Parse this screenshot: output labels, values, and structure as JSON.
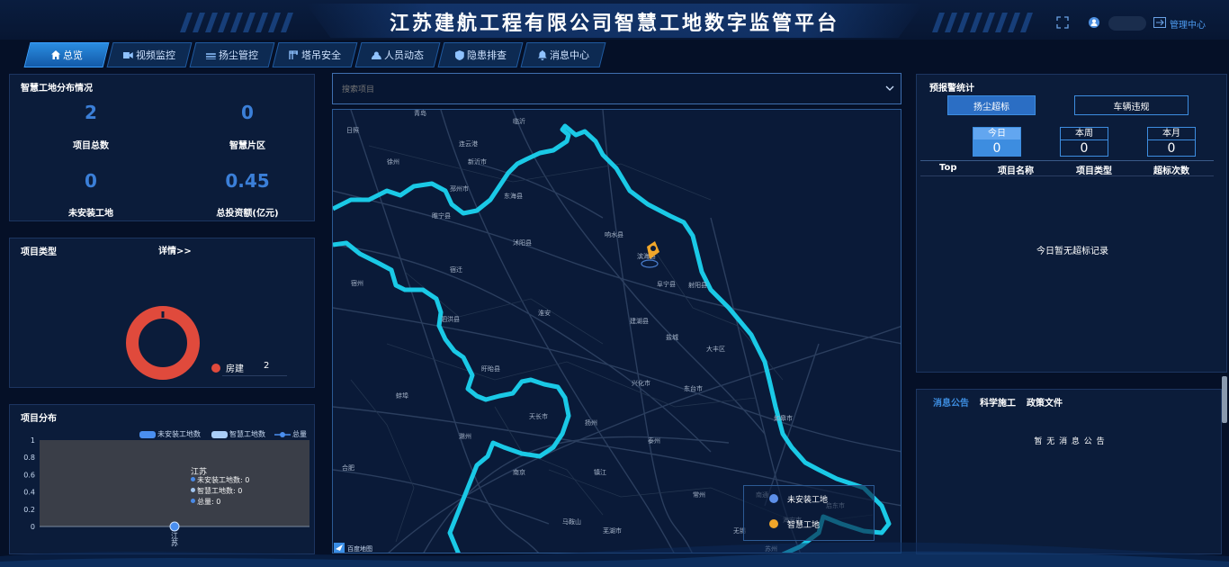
{
  "header": {
    "title": "江苏建航工程有限公司智慧工地数字监管平台",
    "manage_label": "管理中心"
  },
  "nav": {
    "tabs": [
      {
        "label": "总览",
        "icon": "home-icon"
      },
      {
        "label": "视频监控",
        "icon": "video-icon"
      },
      {
        "label": "扬尘管控",
        "icon": "dust-icon"
      },
      {
        "label": "塔吊安全",
        "icon": "crane-icon"
      },
      {
        "label": "人员动态",
        "icon": "person-icon"
      },
      {
        "label": "隐患排查",
        "icon": "shield-icon"
      },
      {
        "label": "消息中心",
        "icon": "bell-icon"
      }
    ]
  },
  "distribution": {
    "title": "智慧工地分布情况",
    "stats": [
      {
        "value": "2",
        "label": "项目总数"
      },
      {
        "value": "0",
        "label": "智慧片区"
      },
      {
        "value": "0",
        "label": "未安装工地"
      },
      {
        "value": "0.45",
        "label": "总投资额(亿元)"
      }
    ]
  },
  "project_type": {
    "title": "项目类型",
    "detail_link": "详情>>",
    "legend": {
      "name": "房建",
      "value": "2"
    },
    "color": "#e04a3c"
  },
  "project_dist": {
    "title": "项目分布",
    "tooltip": {
      "title": "江苏",
      "lines": [
        "未安装工地数: 0",
        "智慧工地数: 0",
        "总量: 0"
      ]
    }
  },
  "chart_data": {
    "type": "bar",
    "categories": [
      "江苏"
    ],
    "series": [
      {
        "name": "未安装工地数",
        "values": [
          0
        ]
      },
      {
        "name": "智慧工地数",
        "values": [
          0
        ]
      },
      {
        "name": "总量",
        "values": [
          0
        ]
      }
    ],
    "yticks": [
      "0",
      "0.2",
      "0.4",
      "0.6",
      "0.8",
      "1"
    ],
    "ylim": [
      0,
      1
    ],
    "xtick_label": "江苏",
    "legend_position": "top-right",
    "colors": {
      "uninstalled": "#4a8ff0",
      "smart": "#a9cdf7",
      "total": "#4a8ff0"
    }
  },
  "search": {
    "placeholder": "搜索项目"
  },
  "map": {
    "logo_text": "百度地图",
    "legend": [
      "未安装工地",
      "智慧工地"
    ],
    "legend_colors": [
      "#5d8fe8",
      "#f0a62a"
    ],
    "boundary_color": "#1ac9e6",
    "city_labels": [
      "青岛",
      "临沂",
      "日照",
      "连云港",
      "东海县",
      "宿迁",
      "沭阳县",
      "泗洪县",
      "淮安",
      "盐城",
      "建湖县",
      "阜宁县",
      "滨海县",
      "响水县",
      "射阳县",
      "大丰区",
      "东台市",
      "兴化市",
      "泰州",
      "扬州",
      "南京",
      "镇江",
      "常州",
      "无锡",
      "苏州",
      "南通",
      "如皋市",
      "海安市",
      "启东市",
      "马鞍山",
      "芜湖市",
      "滁州",
      "天长市",
      "盱眙县",
      "徐州",
      "邳州市",
      "新沂市",
      "睢宁县",
      "宿州",
      "蚌埠",
      "合肥"
    ]
  },
  "alert": {
    "title": "预报警统计",
    "tabs": [
      "扬尘超标",
      "车辆违规"
    ],
    "periods": [
      {
        "label": "今日",
        "value": "0"
      },
      {
        "label": "本周",
        "value": "0"
      },
      {
        "label": "本月",
        "value": "0"
      }
    ],
    "columns": [
      "Top",
      "项目名称",
      "项目类型",
      "超标次数"
    ],
    "empty_text": "今日暂无超标记录"
  },
  "notice": {
    "tabs": [
      "消息公告",
      "科学施工",
      "政策文件"
    ],
    "empty_text": "暂 无 消 息 公 告"
  }
}
